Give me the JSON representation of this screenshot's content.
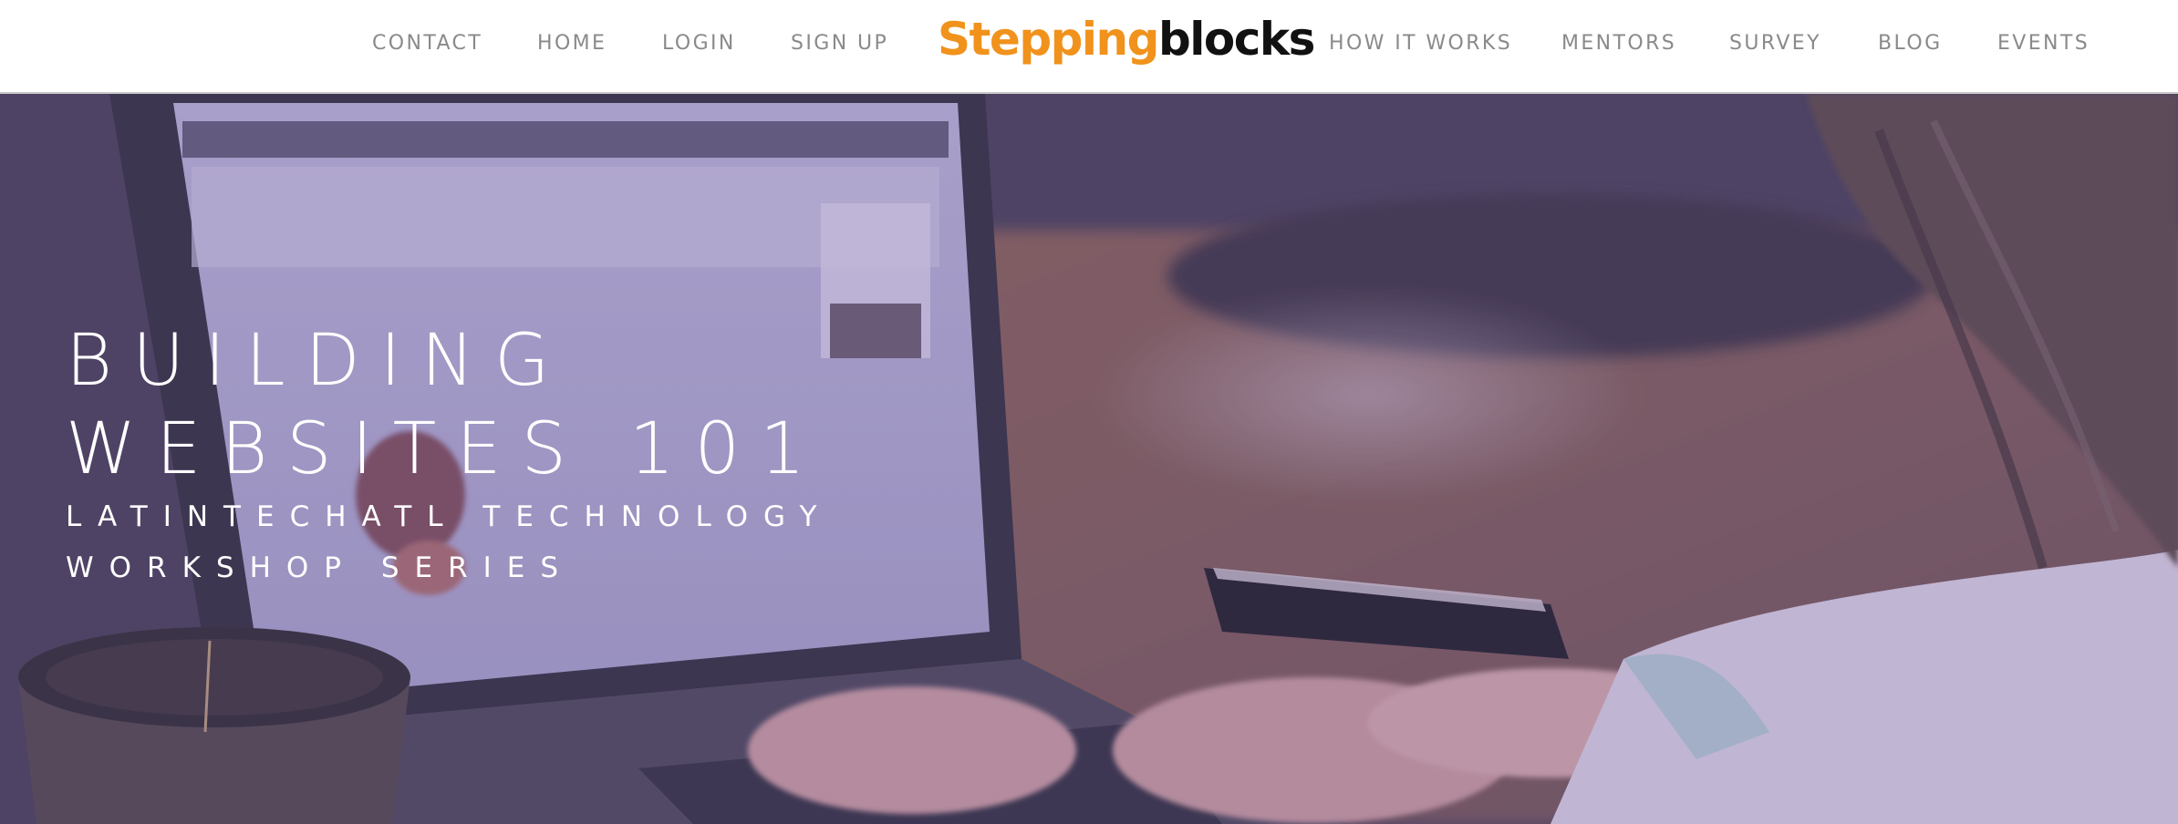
{
  "nav": {
    "left_items": [
      "CONTACT",
      "HOME",
      "LOGIN",
      "SIGN UP"
    ],
    "right_items": [
      "HOW IT WORKS",
      "MENTORS",
      "SURVEY",
      "BLOG",
      "EVENTS"
    ],
    "text_color": "#8a8a8a"
  },
  "logo": {
    "part1": "Stepping",
    "part2": "blocks",
    "accent_color": "#f0921c",
    "dark_color": "#111111"
  },
  "hero": {
    "title_line1": "BUILDING",
    "title_line2": "WEBSITES 101",
    "subtitle_line1": "LATINTECHATL TECHNOLOGY",
    "subtitle_line2": "WORKSHOP SERIES",
    "image": "photo of a person typing on a laptop at a wooden desk with a coffee mug"
  }
}
